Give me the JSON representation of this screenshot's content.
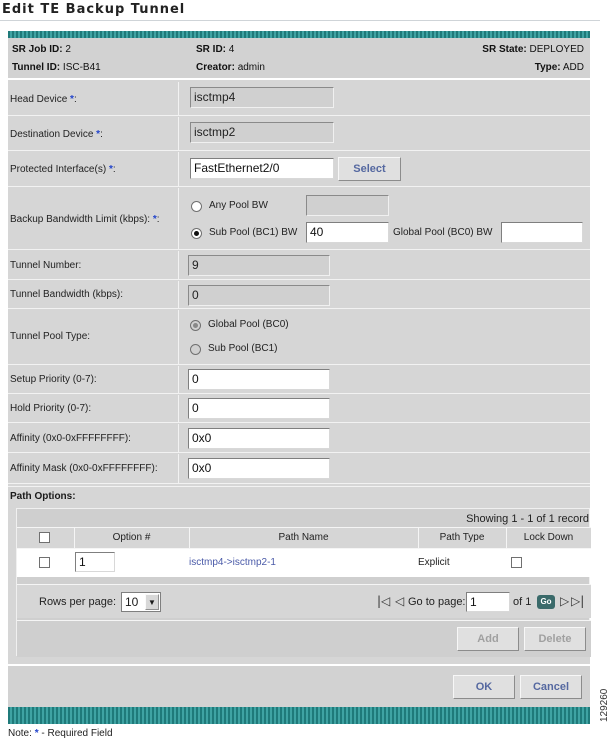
{
  "page": {
    "title": "Edit TE Backup Tunnel",
    "figure_id": "129260"
  },
  "sr_info": {
    "job_id_label": "SR Job ID:",
    "job_id_value": "2",
    "sr_id_label": "SR ID:",
    "sr_id_value": "4",
    "state_label": "SR State:",
    "state_value": "DEPLOYED",
    "tunnel_id_label": "Tunnel ID:",
    "tunnel_id_value": "ISC-B41",
    "creator_label": "Creator:",
    "creator_value": "admin",
    "type_label": "Type:",
    "type_value": "ADD"
  },
  "form": {
    "required_mark": "*",
    "head_device": {
      "label": "Head Device",
      "value": "isctmp4"
    },
    "destination_device": {
      "label": "Destination Device",
      "value": "isctmp2"
    },
    "protected_interface": {
      "label": "Protected Interface(s)",
      "value": "FastEthernet2/0",
      "select_label": "Select"
    },
    "backup_bw": {
      "label": "Backup Bandwidth Limit (kbps):",
      "any_pool_label": "Any Pool BW",
      "any_pool_value": "",
      "sub_pool_label": "Sub Pool (BC1) BW",
      "sub_pool_value": "40",
      "global_pool_label": "Global Pool (BC0) BW",
      "global_pool_value": "",
      "selected": "sub_pool"
    },
    "tunnel_number": {
      "label": "Tunnel Number:",
      "value": "9"
    },
    "tunnel_bandwidth": {
      "label": "Tunnel Bandwidth (kbps):",
      "value": "0"
    },
    "tunnel_pool_type": {
      "label": "Tunnel Pool Type:",
      "global_label": "Global Pool (BC0)",
      "sub_label": "Sub Pool (BC1)",
      "selected": "global"
    },
    "setup_priority": {
      "label": "Setup Priority (0-7):",
      "value": "0"
    },
    "hold_priority": {
      "label": "Hold Priority (0-7):",
      "value": "0"
    },
    "affinity": {
      "label": "Affinity (0x0-0xFFFFFFFF):",
      "value": "0x0"
    },
    "affinity_mask": {
      "label": "Affinity Mask (0x0-0xFFFFFFFF):",
      "value": "0x0"
    }
  },
  "path_options": {
    "section_label": "Path Options:",
    "showing_text": "Showing 1 - 1 of 1 record",
    "columns": [
      "Option #",
      "Path Name",
      "Path Type",
      "Lock Down"
    ],
    "rows": [
      {
        "option": "1",
        "path_name": "isctmp4->isctmp2-1",
        "path_type": "Explicit",
        "lock_down": false
      }
    ],
    "rows_per_page_label": "Rows per page:",
    "rows_per_page_value": "10",
    "goto_label": "Go to page:",
    "goto_value": "1",
    "of_label": "of 1",
    "go_label": "Go",
    "add_label": "Add",
    "delete_label": "Delete"
  },
  "footer": {
    "ok_label": "OK",
    "cancel_label": "Cancel",
    "note_prefix": "Note:",
    "note_star": "*",
    "note_text": "- Required Field"
  },
  "colors": {
    "teal_band": "#1f7a7a",
    "required_star": "#2244cc",
    "button_text": "#5568a0",
    "link": "#4a5aa8"
  }
}
